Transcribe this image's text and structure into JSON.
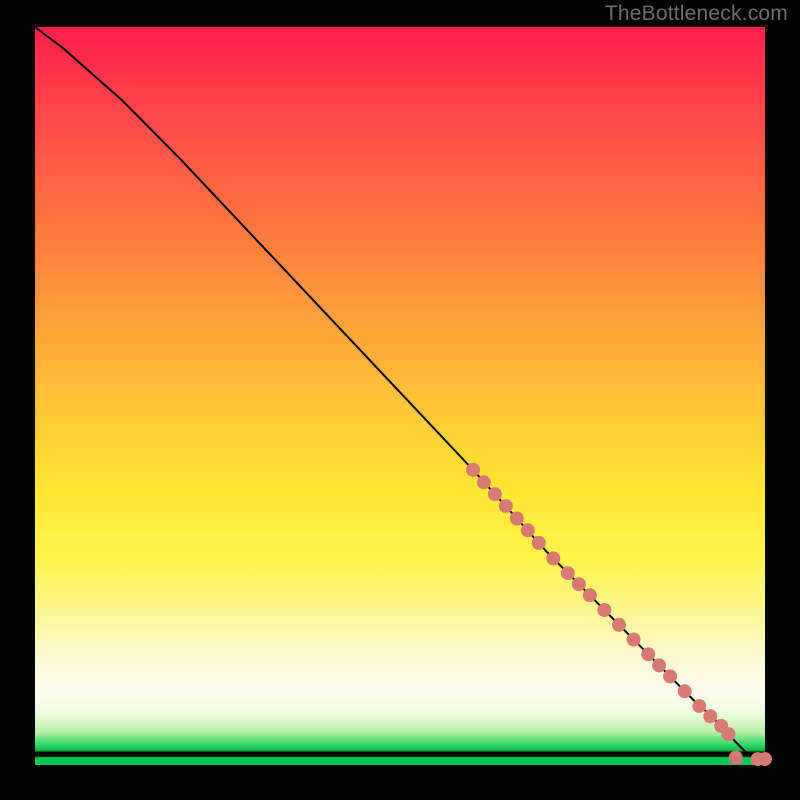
{
  "watermark": "TheBottleneck.com",
  "colors": {
    "curve": "#000000",
    "marker": "#d87a74",
    "background": "#000000"
  },
  "chart_data": {
    "type": "line",
    "title": "",
    "xlabel": "",
    "ylabel": "",
    "xlim": [
      0,
      100
    ],
    "ylim": [
      0,
      100
    ],
    "grid": false,
    "legend": false,
    "series": [
      {
        "name": "curve",
        "x": [
          0,
          4,
          8,
          12,
          20,
          30,
          40,
          50,
          60,
          65,
          70,
          74,
          78,
          82,
          85,
          88,
          90,
          92,
          94,
          95,
          96,
          97,
          98,
          99,
          100
        ],
        "y": [
          100,
          97,
          93.5,
          90,
          82,
          71.5,
          61,
          50.5,
          40,
          34.5,
          29,
          25,
          21,
          17,
          14,
          11,
          9,
          7.2,
          5.3,
          4.2,
          3.1,
          2.1,
          1.2,
          0.8,
          0.8
        ]
      }
    ],
    "markers": [
      {
        "x": 60.0,
        "y": 40.0
      },
      {
        "x": 61.5,
        "y": 38.3
      },
      {
        "x": 63.0,
        "y": 36.7
      },
      {
        "x": 64.5,
        "y": 35.1
      },
      {
        "x": 66.0,
        "y": 33.4
      },
      {
        "x": 67.5,
        "y": 31.8
      },
      {
        "x": 69.0,
        "y": 30.1
      },
      {
        "x": 71.0,
        "y": 28.0
      },
      {
        "x": 73.0,
        "y": 26.0
      },
      {
        "x": 74.5,
        "y": 24.5
      },
      {
        "x": 76.0,
        "y": 23.0
      },
      {
        "x": 78.0,
        "y": 21.0
      },
      {
        "x": 80.0,
        "y": 19.0
      },
      {
        "x": 82.0,
        "y": 17.0
      },
      {
        "x": 84.0,
        "y": 15.0
      },
      {
        "x": 85.5,
        "y": 13.5
      },
      {
        "x": 87.0,
        "y": 12.0
      },
      {
        "x": 89.0,
        "y": 10.0
      },
      {
        "x": 91.0,
        "y": 8.0
      },
      {
        "x": 92.5,
        "y": 6.6
      },
      {
        "x": 94.0,
        "y": 5.3
      },
      {
        "x": 95.0,
        "y": 4.2
      },
      {
        "x": 96.0,
        "y": 1.0
      },
      {
        "x": 99.0,
        "y": 0.8
      },
      {
        "x": 100.0,
        "y": 0.8
      }
    ]
  }
}
